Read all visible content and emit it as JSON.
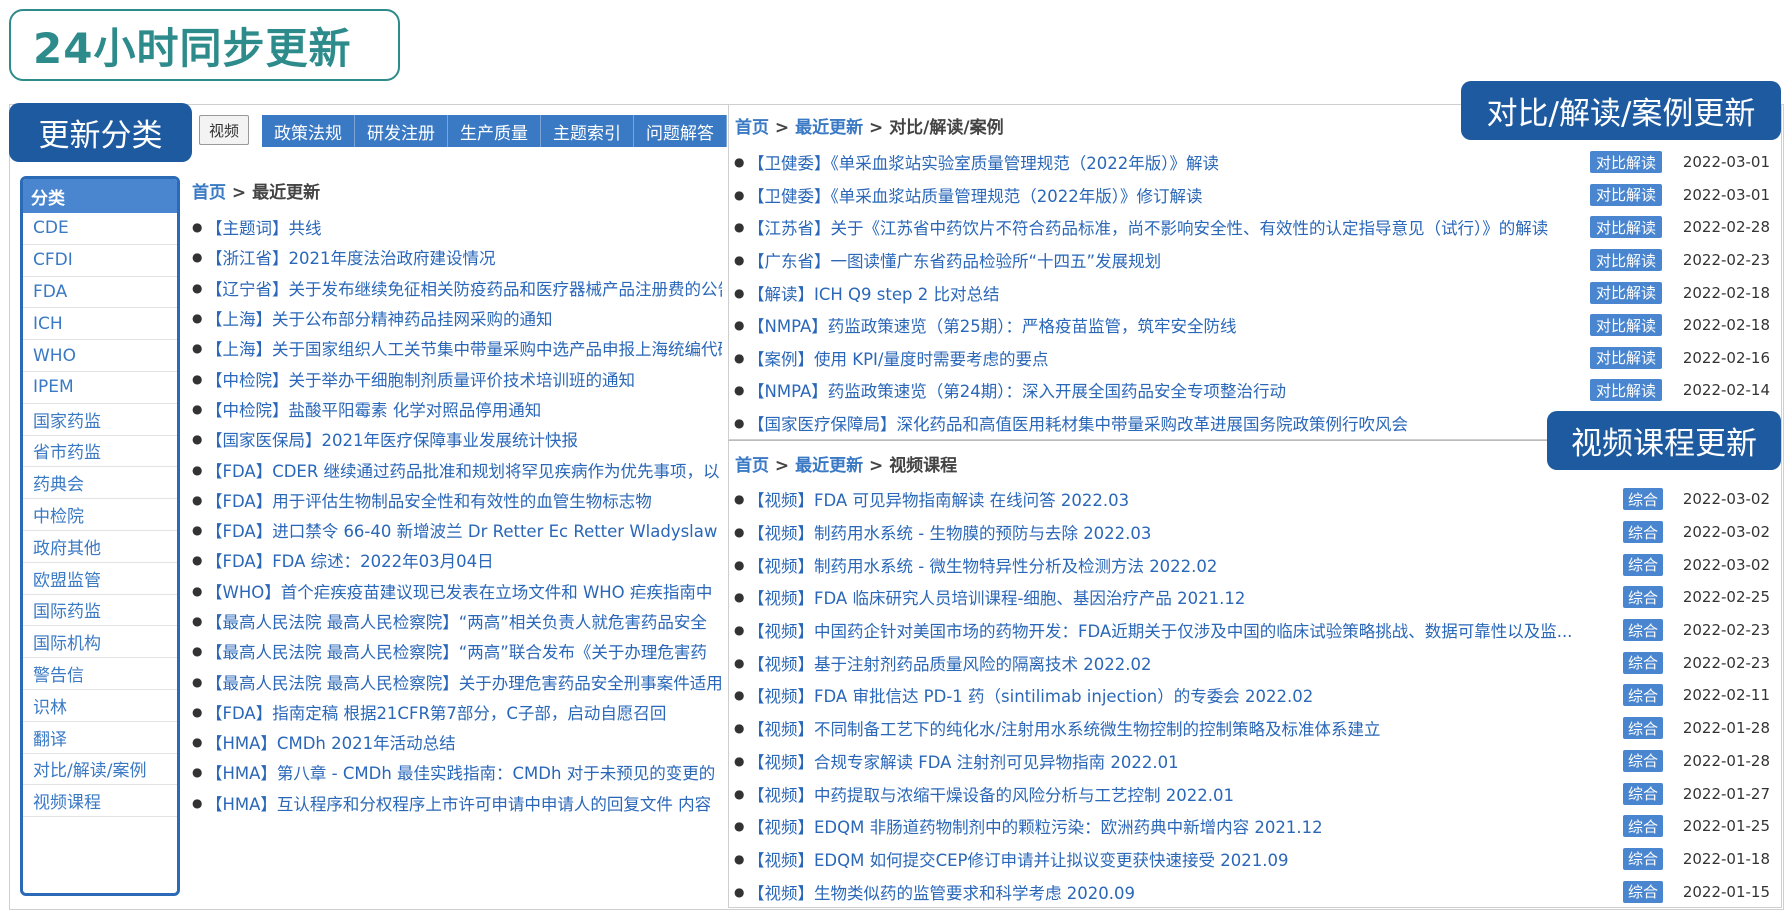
{
  "headline": "24小时同步更新",
  "callouts": {
    "category": "更新分类",
    "compare": "对比/解读/案例更新",
    "video": "视频课程更新"
  },
  "nav": {
    "video_button": "视频",
    "tabs": [
      "政策法规",
      "研发注册",
      "生产质量",
      "主题索引",
      "问题解答"
    ]
  },
  "sidebar": {
    "title": "分类",
    "items": [
      "CDE",
      "CFDI",
      "FDA",
      "ICH",
      "WHO",
      "IPEM",
      "国家药监",
      "省市药监",
      "药典会",
      "中检院",
      "政府其他",
      "欧盟监管",
      "国际药监",
      "国际机构",
      "警告信",
      "识林",
      "翻译",
      "对比/解读/案例",
      "视频课程"
    ]
  },
  "breadcrumb_main": {
    "home": "首页",
    "sep": ">",
    "current": "最近更新"
  },
  "breadcrumb_compare": {
    "home": "首页",
    "sep1": ">",
    "mid": "最近更新",
    "sep2": ">",
    "current": "对比/解读/案例"
  },
  "breadcrumb_video": {
    "home": "首页",
    "sep1": ">",
    "mid": "最近更新",
    "sep2": ">",
    "current": "视频课程"
  },
  "main_list": [
    "【主题词】共线",
    "【浙江省】2021年度法治政府建设情况",
    "【辽宁省】关于发布继续免征相关防疫药品和医疗器械产品注册费的公告",
    "【上海】关于公布部分精神药品挂网采购的通知",
    "【上海】关于国家组织人工关节集中带量采购中选产品申报上海统编代码",
    "【中检院】关于举办干细胞制剂质量评价技术培训班的通知",
    "【中检院】盐酸平阳霉素 化学对照品停用通知",
    "【国家医保局】2021年医疗保障事业发展统计快报",
    "【FDA】CDER 继续通过药品批准和规划将罕见疾病作为优先事项，以",
    "【FDA】用于评估生物制品安全性和有效性的血管生物标志物",
    "【FDA】进口禁令 66-40 新增波兰 Dr Retter Ec Retter Wladyslaw",
    "【FDA】FDA 综述：2022年03月04日",
    "【WHO】首个疟疾疫苗建议现已发表在立场文件和 WHO 疟疾指南中",
    "【最高人民法院 最高人民检察院】“两高”相关负责人就危害药品安全",
    "【最高人民法院 最高人民检察院】“两高”联合发布《关于办理危害药",
    "【最高人民法院 最高人民检察院】关于办理危害药品安全刑事案件适用",
    "【FDA】指南定稿 根据21CFR第7部分，C子部，启动自愿召回",
    "【HMA】CMDh 2021年活动总结",
    "【HMA】第八章 - CMDh 最佳实践指南：CMDh 对于未预见的变更的",
    "【HMA】互认程序和分权程序上市许可申请中申请人的回复文件 内容"
  ],
  "compare_list": [
    {
      "text": "【卫健委】《单采血浆站实验室质量管理规范（2022年版）》解读",
      "tag": "对比解读",
      "date": "2022-03-01"
    },
    {
      "text": "【卫健委】《单采血浆站质量管理规范（2022年版）》修订解读",
      "tag": "对比解读",
      "date": "2022-03-01"
    },
    {
      "text": "【江苏省】关于《江苏省中药饮片不符合药品标准，尚不影响安全性、有效性的认定指导意见（试行）》的解读",
      "tag": "对比解读",
      "date": "2022-02-28"
    },
    {
      "text": "【广东省】一图读懂广东省药品检验所“十四五”发展规划",
      "tag": "对比解读",
      "date": "2022-02-23"
    },
    {
      "text": "【解读】ICH Q9 step 2 比对总结",
      "tag": "对比解读",
      "date": "2022-02-18"
    },
    {
      "text": "【NMPA】药监政策速览（第25期）：严格疫苗监管，筑牢安全防线",
      "tag": "对比解读",
      "date": "2022-02-18"
    },
    {
      "text": "【案例】使用 KPI/量度时需要考虑的要点",
      "tag": "对比解读",
      "date": "2022-02-16"
    },
    {
      "text": "【NMPA】药监政策速览（第24期）：深入开展全国药品安全专项整治行动",
      "tag": "对比解读",
      "date": "2022-02-14"
    },
    {
      "text": "【国家医疗保障局】深化药品和高值医用耗材集中带量采购改革进展国务院政策例行吹风会",
      "tag": "",
      "date": ""
    }
  ],
  "video_list": [
    {
      "text": "【视频】FDA 可见异物指南解读 在线问答 2022.03",
      "tag": "综合",
      "date": "2022-03-02"
    },
    {
      "text": "【视频】制药用水系统 - 生物膜的预防与去除 2022.03",
      "tag": "综合",
      "date": "2022-03-02"
    },
    {
      "text": "【视频】制药用水系统 - 微生物特异性分析及检测方法 2022.02",
      "tag": "综合",
      "date": "2022-03-02"
    },
    {
      "text": "【视频】FDA 临床研究人员培训课程-细胞、基因治疗产品 2021.12",
      "tag": "综合",
      "date": "2022-02-25"
    },
    {
      "text": "【视频】中国药企针对美国市场的药物开发：FDA近期关于仅涉及中国的临床试验策略挑战、数据可靠性以及监...",
      "tag": "综合",
      "date": "2022-02-23"
    },
    {
      "text": "【视频】基于注射剂药品质量风险的隔离技术 2022.02",
      "tag": "综合",
      "date": "2022-02-23"
    },
    {
      "text": "【视频】FDA 审批信达 PD-1 药（sintilimab injection）的专委会 2022.02",
      "tag": "综合",
      "date": "2022-02-11"
    },
    {
      "text": "【视频】不同制备工艺下的纯化水/注射用水系统微生物控制的控制策略及标准体系建立",
      "tag": "综合",
      "date": "2022-01-28"
    },
    {
      "text": "【视频】合规专家解读 FDA 注射剂可见异物指南 2022.01",
      "tag": "综合",
      "date": "2022-01-28"
    },
    {
      "text": "【视频】中药提取与浓缩干燥设备的风险分析与工艺控制 2022.01",
      "tag": "综合",
      "date": "2022-01-27"
    },
    {
      "text": "【视频】EDQM 非肠道药物制剂中的颗粒污染：欧洲药典中新增内容 2021.12",
      "tag": "综合",
      "date": "2022-01-25"
    },
    {
      "text": "【视频】EDQM 如何提交CEP修订申请并让拟议变更获快速接受 2021.09",
      "tag": "综合",
      "date": "2022-01-18"
    },
    {
      "text": "【视频】生物类似药的监管要求和科学考虑 2020.09",
      "tag": "综合",
      "date": "2022-01-15"
    }
  ]
}
